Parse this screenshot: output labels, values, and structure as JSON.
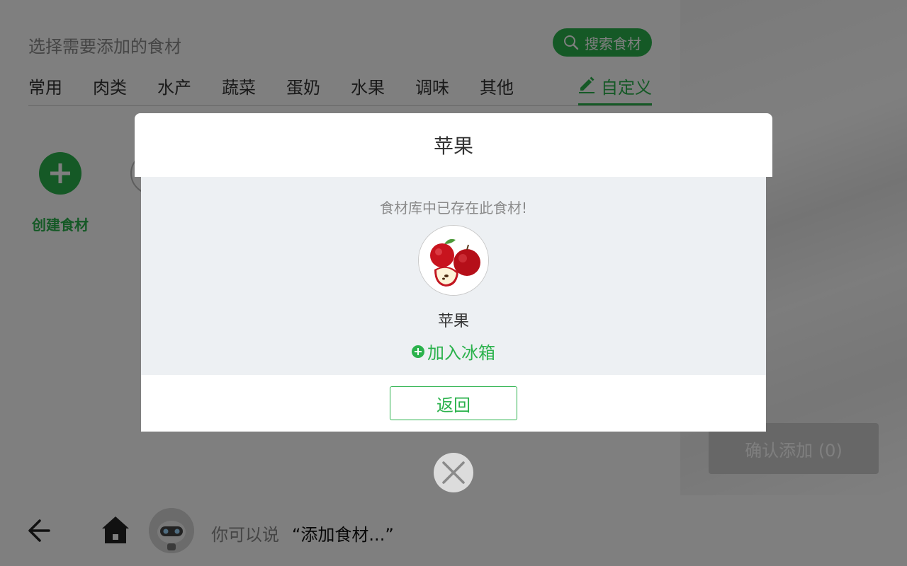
{
  "header": {
    "hint": "选择需要添加的食材",
    "search_label": "搜索食材"
  },
  "tabs": [
    {
      "label": "常用"
    },
    {
      "label": "肉类"
    },
    {
      "label": "水产"
    },
    {
      "label": "蔬菜"
    },
    {
      "label": "蛋奶"
    },
    {
      "label": "水果"
    },
    {
      "label": "调味"
    },
    {
      "label": "其他"
    }
  ],
  "custom_tab": {
    "label": "自定义",
    "active": true
  },
  "create": {
    "label": "创建食材"
  },
  "confirm": {
    "label": "确认添加 (0)"
  },
  "voice": {
    "prompt": "你可以说",
    "example": "“添加食材...”"
  },
  "dialog": {
    "title": "苹果",
    "message": "食材库中已存在此食材!",
    "item_name": "苹果",
    "add_label": "加入冰箱",
    "return_label": "返回"
  },
  "colors": {
    "accent": "#2bb24c",
    "overlay": "rgba(0,0,0,0.5)",
    "dialog_body": "#edf0f3"
  }
}
